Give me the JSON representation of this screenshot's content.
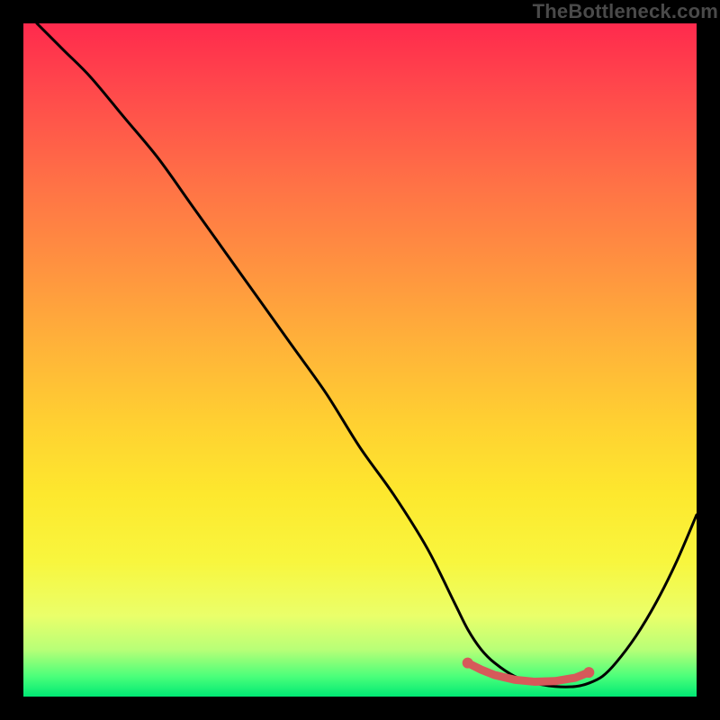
{
  "watermark": "TheBottleneck.com",
  "chart_data": {
    "type": "line",
    "title": "",
    "xlabel": "",
    "ylabel": "",
    "x_range": [
      0,
      100
    ],
    "y_range": [
      0,
      100
    ],
    "series": [
      {
        "name": "bottleneck-curve",
        "x": [
          2,
          6,
          10,
          15,
          20,
          25,
          30,
          35,
          40,
          45,
          50,
          55,
          60,
          64,
          66,
          68,
          70,
          73,
          76,
          79,
          82,
          84,
          86,
          88,
          91,
          94,
          97,
          100
        ],
        "y": [
          100,
          96,
          92,
          86,
          80,
          73,
          66,
          59,
          52,
          45,
          37,
          30,
          22,
          14,
          10,
          7,
          5,
          3,
          2,
          1.5,
          1.5,
          2,
          3,
          5,
          9,
          14,
          20,
          27
        ]
      }
    ],
    "highlight": {
      "name": "optimal-range",
      "x": [
        66,
        68,
        70,
        73,
        76,
        79,
        82,
        84
      ],
      "y": [
        5,
        4,
        3.2,
        2.5,
        2.2,
        2.3,
        2.8,
        3.6
      ]
    },
    "gradient_stops": [
      {
        "pos": 0,
        "color": "#ff2a4d"
      },
      {
        "pos": 12,
        "color": "#ff4f4b"
      },
      {
        "pos": 24,
        "color": "#ff7246"
      },
      {
        "pos": 36,
        "color": "#ff9240"
      },
      {
        "pos": 48,
        "color": "#ffb339"
      },
      {
        "pos": 60,
        "color": "#ffd231"
      },
      {
        "pos": 70,
        "color": "#fde82e"
      },
      {
        "pos": 80,
        "color": "#f8f63e"
      },
      {
        "pos": 88,
        "color": "#eaff6a"
      },
      {
        "pos": 93,
        "color": "#b8ff77"
      },
      {
        "pos": 97,
        "color": "#4bff7a"
      },
      {
        "pos": 100,
        "color": "#00e874"
      }
    ],
    "colors": {
      "curve": "#000000",
      "highlight": "#d65a5a",
      "background_frame": "#000000"
    }
  }
}
